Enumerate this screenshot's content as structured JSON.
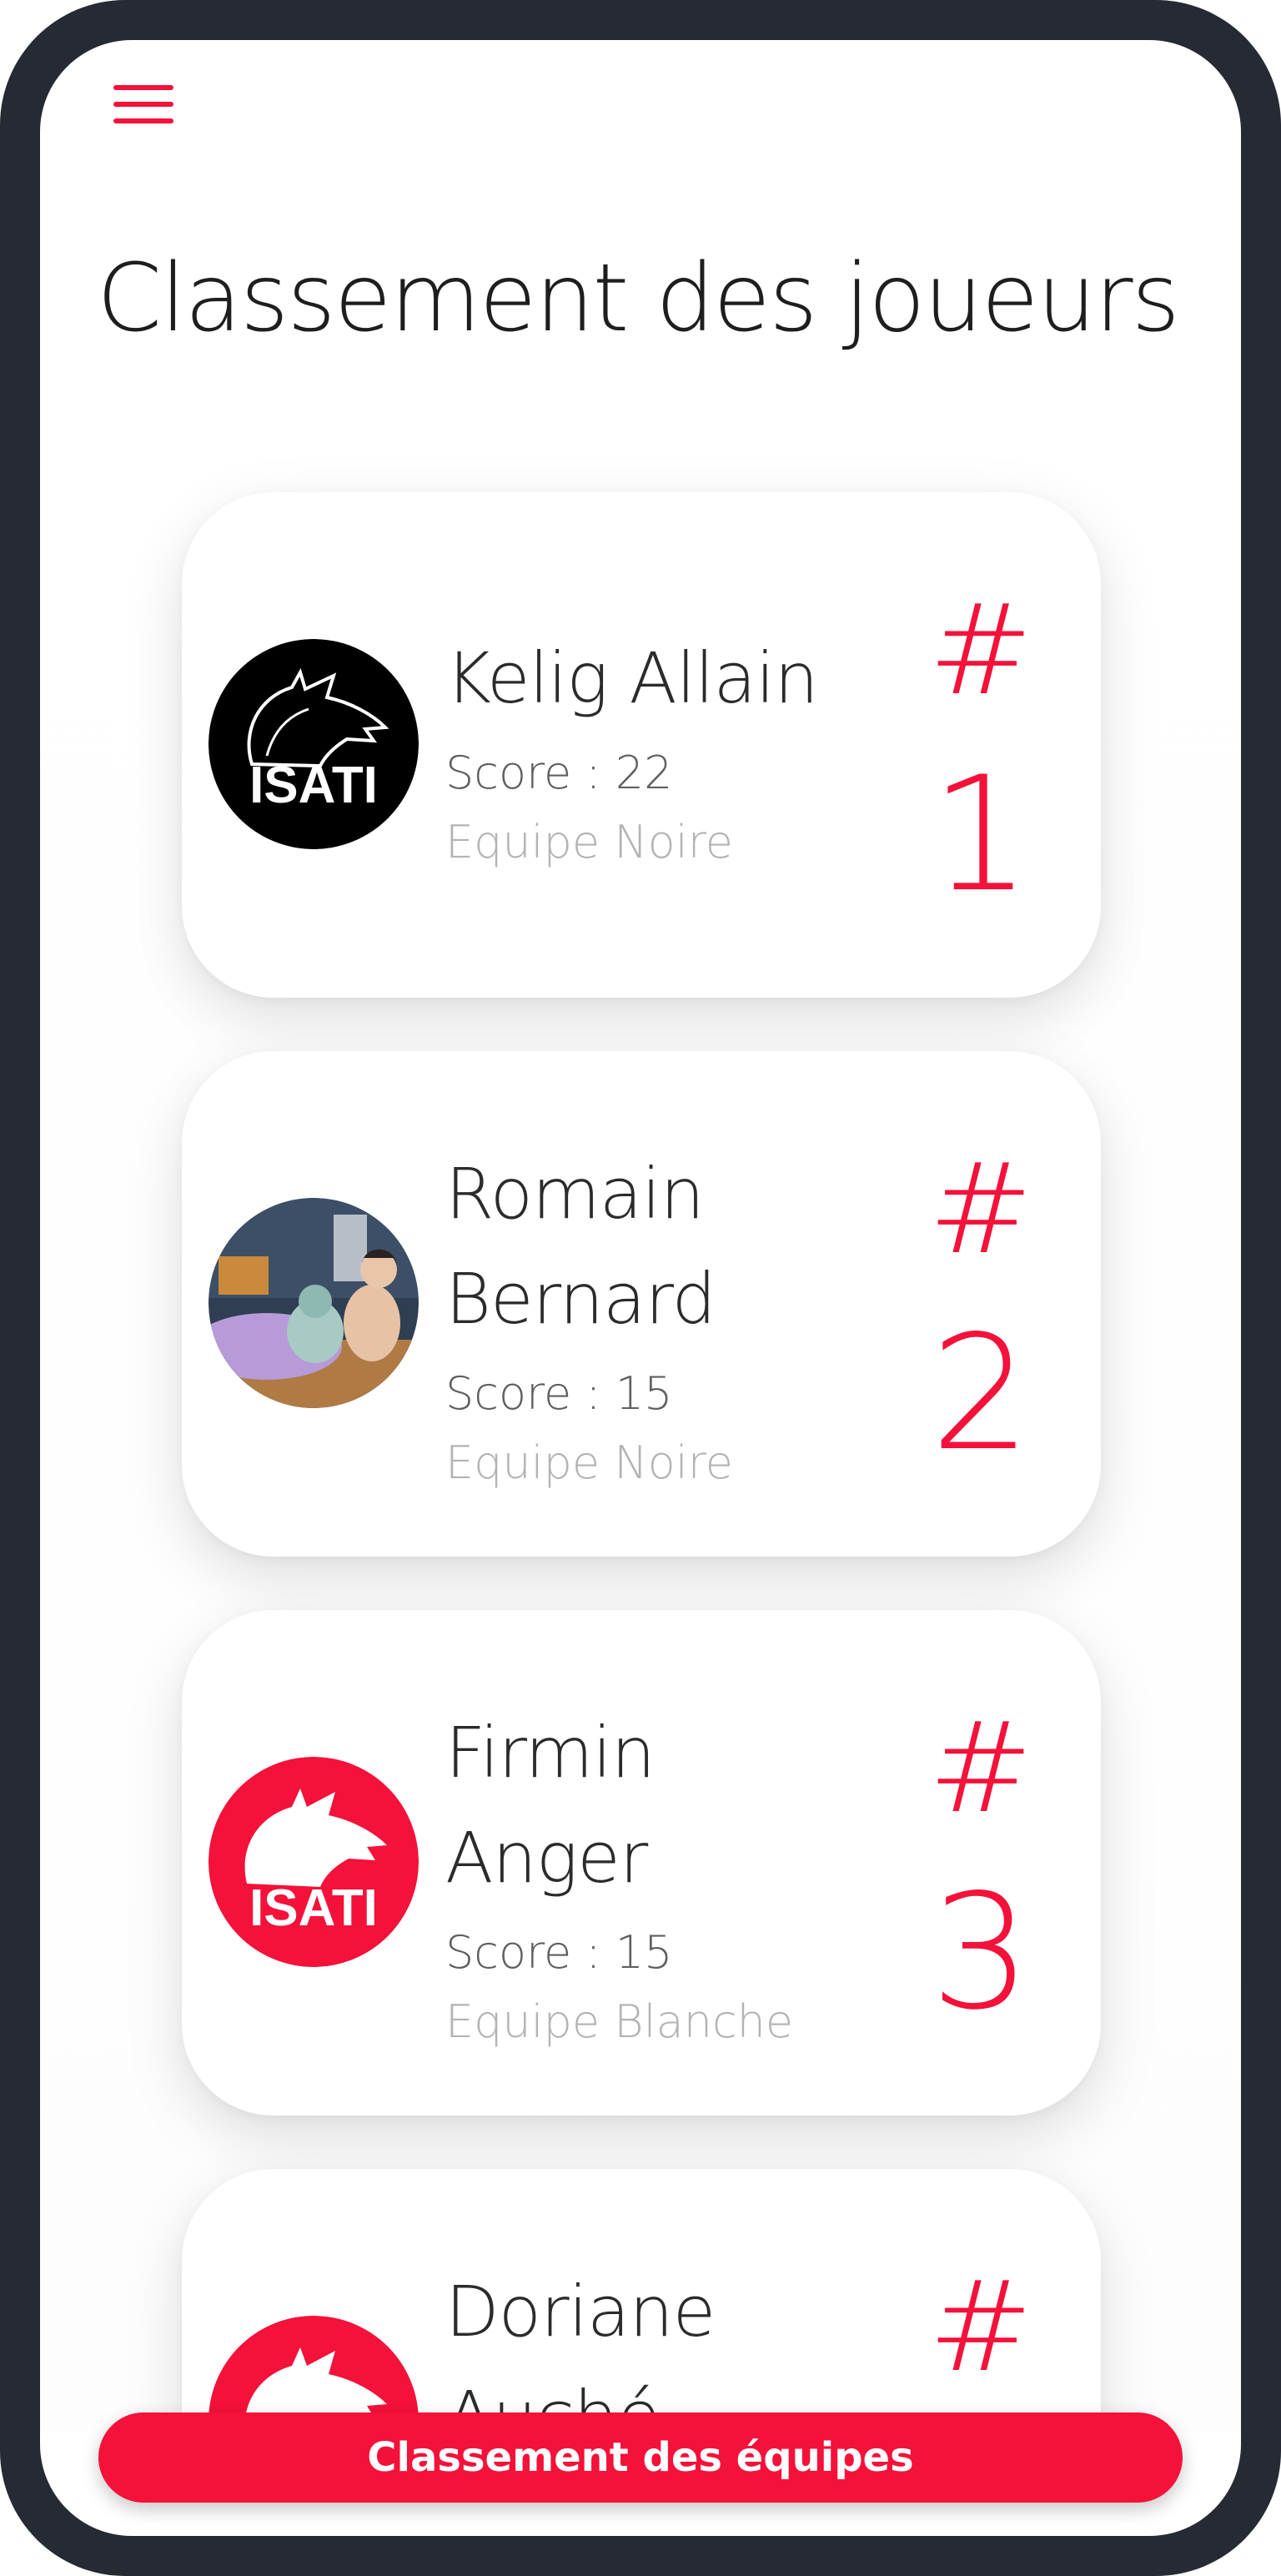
{
  "header": {
    "menu_icon": "hamburger-menu-icon",
    "title": "Classement des joueurs"
  },
  "players": [
    {
      "name": "Kelig Allain",
      "score": "Score : 22",
      "team": "Equipe Noire",
      "rank_prefix": "#",
      "rank": "1",
      "avatar": "isati-wolf-logo-black"
    },
    {
      "name": "Romain Bernard",
      "score": "Score : 15",
      "team": "Equipe Noire",
      "rank_prefix": "#",
      "rank": "2",
      "avatar": "user-photo"
    },
    {
      "name": "Firmin Anger",
      "score": "Score : 15",
      "team": "Equipe Blanche",
      "rank_prefix": "#",
      "rank": "3",
      "avatar": "isati-wolf-logo-red"
    },
    {
      "name": "Doriane Auché",
      "rank_prefix": "#",
      "avatar": "isati-wolf-logo-red"
    }
  ],
  "footer": {
    "team_ranking_label": "Classement des équipes"
  },
  "colors": {
    "accent": "#f4113a",
    "frame": "#252a33",
    "text_dark": "#2b2b2b",
    "text_muted": "#b3b3b3"
  }
}
